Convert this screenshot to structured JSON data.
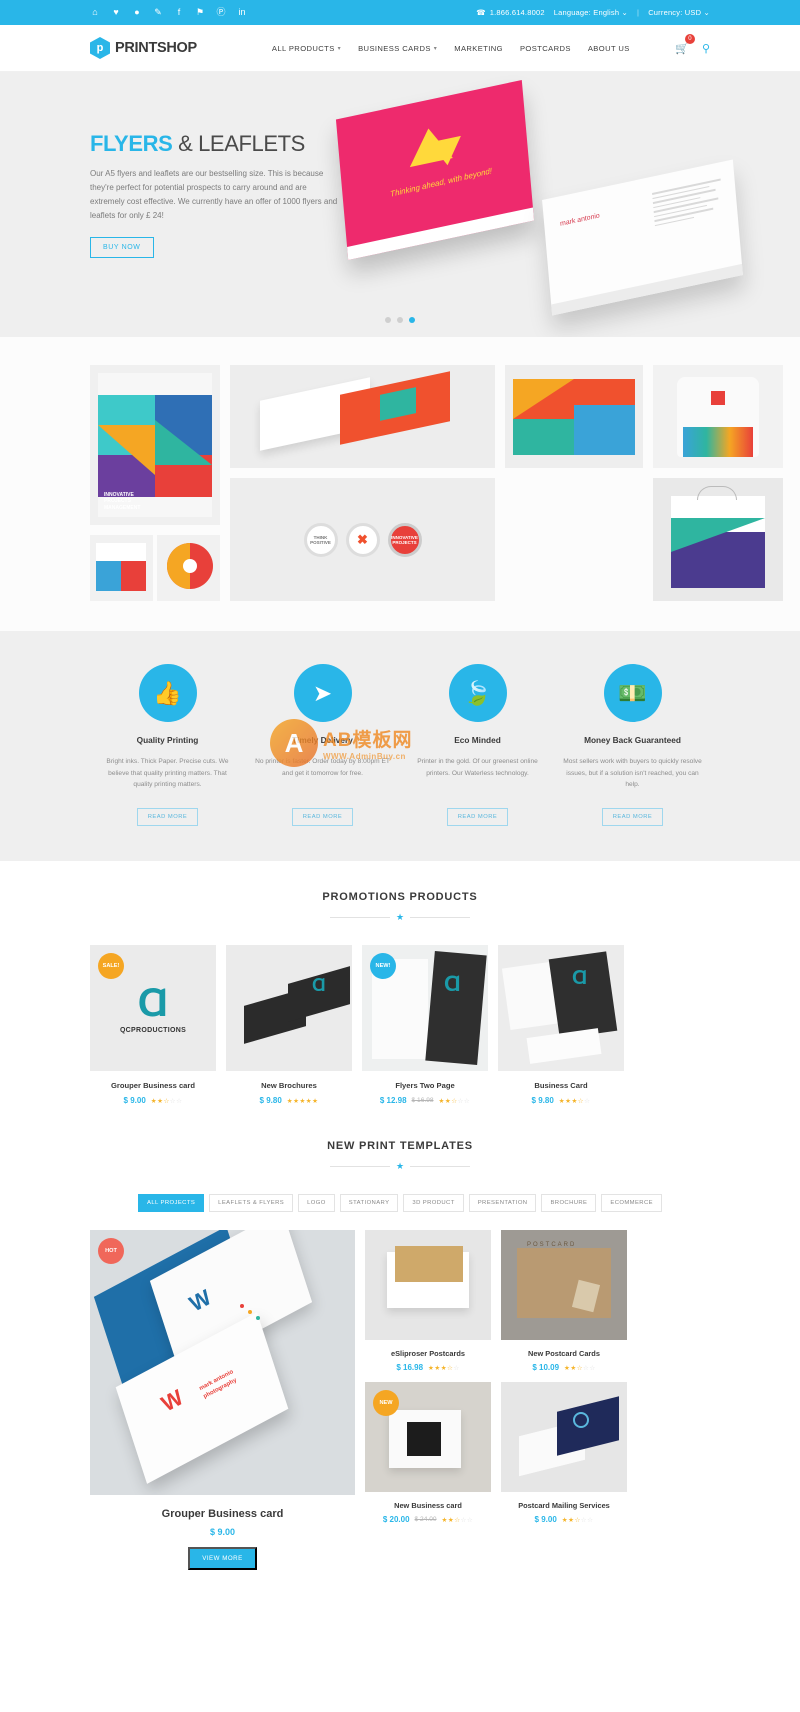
{
  "topbar": {
    "social": [
      {
        "name": "rss-icon",
        "glyph": "⌂"
      },
      {
        "name": "heart-icon",
        "glyph": "♥"
      },
      {
        "name": "dribbble-icon",
        "glyph": "●"
      },
      {
        "name": "pencil-icon",
        "glyph": "✎"
      },
      {
        "name": "facebook-icon",
        "glyph": "f"
      },
      {
        "name": "twitter-icon",
        "glyph": "⚑"
      },
      {
        "name": "pinterest-icon",
        "glyph": "Ⓟ"
      },
      {
        "name": "linkedin-icon",
        "glyph": "in"
      }
    ],
    "phone_icon": "☎",
    "phone": "1.866.614.8002",
    "language": "Language: English",
    "currency": "Currency: USD",
    "separator": "|",
    "caret": "⌄"
  },
  "header": {
    "logo_text": "PRINTSHOP",
    "logo_mark": "p",
    "nav": [
      {
        "label": "ALL PRODUCTS",
        "has_caret": true
      },
      {
        "label": "BUSINESS CARDS",
        "has_caret": true
      },
      {
        "label": "MARKETING",
        "has_caret": false
      },
      {
        "label": "POSTCARDS",
        "has_caret": false
      },
      {
        "label": "ABOUT US",
        "has_caret": false
      }
    ],
    "cart_icon": "🛒",
    "cart_count": "0",
    "search_icon": "⚲"
  },
  "hero": {
    "title_highlight": "FLYERS",
    "title_rest": "& LEAFLETS",
    "description": "Our A5 flyers and leaflets are our bestselling size. This is because they're perfect for potential prospects to carry around and are extremely cost effective. We currently have an offer of 1000 flyers and leaflets for only £ 24!",
    "button": "BUY NOW",
    "card_script": "Thinking ahead, with beyond!",
    "card_brand": "mark antonio",
    "white_brand": "mark antonio",
    "white_phone": "+34 934 456 789",
    "slides": 3,
    "active_slide": 2
  },
  "features": {
    "items": [
      {
        "icon": "👍",
        "icon_name": "thumbs-up-icon",
        "title": "Quality Printing",
        "desc": "Bright inks. Thick Paper. Precise cuts. We believe that quality printing matters. That quality printing matters.",
        "button": "READ MORE"
      },
      {
        "icon": "➤",
        "icon_name": "paper-plane-icon",
        "title": "Timely Delivery",
        "desc": "No printer is faster. Order today by 8:00pm ET and get it tomorrow for free.",
        "button": "READ MORE"
      },
      {
        "icon": "🍃",
        "icon_name": "leaf-icon",
        "title": "Eco Minded",
        "desc": "Printer in the gold. Of our greenest online printers. Our Waterless technology.",
        "button": "READ MORE"
      },
      {
        "icon": "💵",
        "icon_name": "money-icon",
        "title": "Money Back Guaranteed",
        "desc": "Most sellers work with buyers to quickly resolve issues, but if a solution isn't reached, you can help.",
        "button": "READ MORE"
      }
    ],
    "watermark_letter": "A",
    "watermark_title": "AB模板网",
    "watermark_sub": "WWW.AdminBuy.cn"
  },
  "promotions": {
    "title": "PROMOTIONS PRODUCTS",
    "star": "★",
    "products": [
      {
        "name": "Grouper Business card",
        "price": "$ 9.00",
        "price_old": "",
        "rating": 2.5,
        "tag": "SALE!",
        "tag_type": "sale",
        "logo": "Ɑ",
        "logo_label": "QCPRODUCTIONS"
      },
      {
        "name": "New Brochures",
        "price": "$ 9.80",
        "price_old": "",
        "rating": 5,
        "tag": "",
        "tag_type": "",
        "logo": "",
        "logo_label": ""
      },
      {
        "name": "Flyers Two Page",
        "price": "$ 12.98",
        "price_old": "$ 16.98",
        "rating": 2.5,
        "tag": "NEW!",
        "tag_type": "new",
        "logo": "",
        "logo_label": ""
      },
      {
        "name": "Business Card",
        "price": "$ 9.80",
        "price_old": "",
        "rating": 3.5,
        "tag": "",
        "tag_type": "",
        "logo": "",
        "logo_label": ""
      }
    ]
  },
  "templates": {
    "title": "NEW PRINT TEMPLATES",
    "star": "★",
    "filters": [
      {
        "label": "ALL PROJECTS",
        "active": true
      },
      {
        "label": "LEAFLETS & FLYERS",
        "active": false
      },
      {
        "label": "LOGO",
        "active": false
      },
      {
        "label": "STATIONARY",
        "active": false
      },
      {
        "label": "3D PRODUCT",
        "active": false
      },
      {
        "label": "PRESENTATION",
        "active": false
      },
      {
        "label": "BROCHURE",
        "active": false
      },
      {
        "label": "ECOMMERCE",
        "active": false
      }
    ],
    "featured": {
      "name": "Grouper Business card",
      "price": "$ 9.00",
      "button": "VIEW MORE",
      "tag": "HOT",
      "tag_type": "hot"
    },
    "items": [
      {
        "name": "eSliproser Postcards",
        "price": "$ 16.98",
        "price_old": "",
        "rating": 3.5,
        "tag": "",
        "tag_type": ""
      },
      {
        "name": "New Postcard Cards",
        "price": "$ 10.09",
        "price_old": "",
        "rating": 2.5,
        "tag": "",
        "tag_type": ""
      },
      {
        "name": "New Business card",
        "price": "$ 20.00",
        "price_old": "$ 24.00",
        "rating": 2.5,
        "tag": "NEW",
        "tag_type": "new-orange"
      },
      {
        "name": "Postcard Mailing Services",
        "price": "$ 9.00",
        "price_old": "",
        "rating": 2.5,
        "tag": "",
        "tag_type": ""
      }
    ]
  },
  "colors": {
    "brand": "#29b6e8",
    "price": "#29b6e8",
    "star": "#f5b429",
    "sale": "#f5a623",
    "hot": "#f0675a",
    "cart_badge": "#e8413a"
  }
}
